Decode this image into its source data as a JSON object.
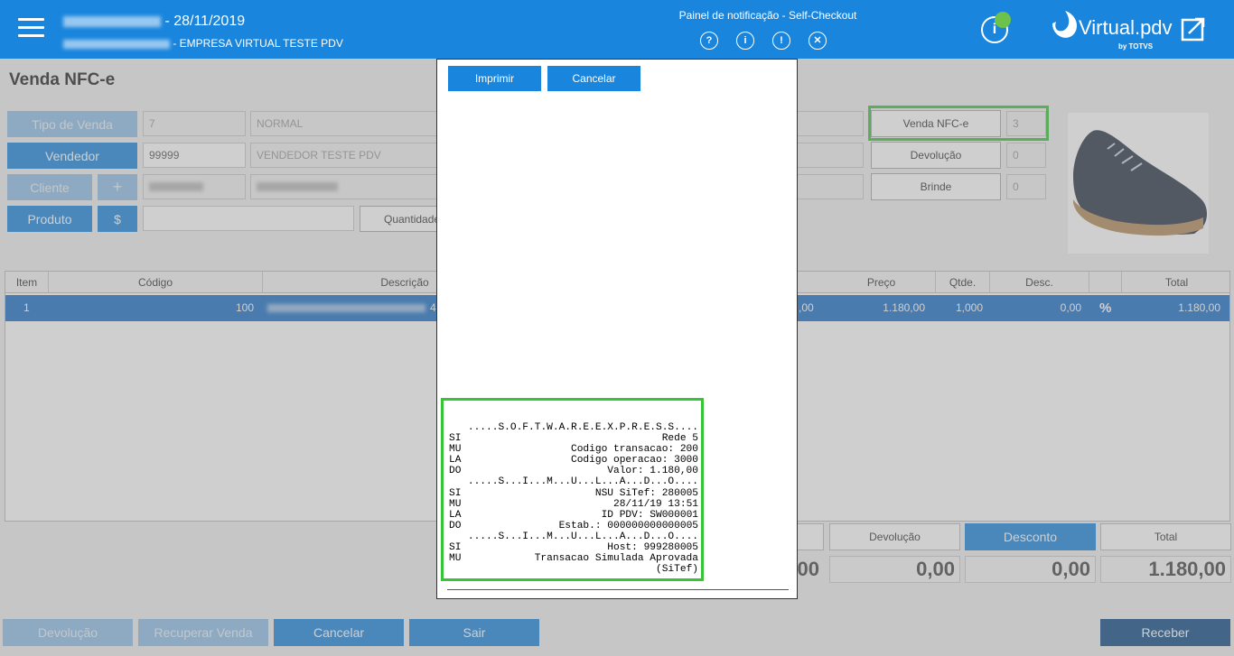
{
  "header": {
    "store_date": "- 28/11/2019",
    "company_name": "- EMPRESA VIRTUAL TESTE PDV",
    "notification_title": "Painel de notificação - Self-Checkout",
    "notification_icons": [
      "question-icon",
      "info-icon",
      "alert-icon",
      "close-icon"
    ],
    "brand_name": "Virtual.pdv",
    "brand_sub": "by TOTVS",
    "accent_color": "#1a85dd",
    "status_color": "#6cc24a"
  },
  "page": {
    "title": "Venda NFC-e"
  },
  "form": {
    "tipo_venda_label": "Tipo de Venda",
    "tipo_venda_code": "7",
    "tipo_venda_desc": "NORMAL",
    "vendedor_label": "Vendedor",
    "vendedor_code": "99999",
    "vendedor_name": "VENDEDOR TESTE PDV",
    "cliente_label": "Cliente",
    "cliente_add": "+",
    "produto_label": "Produto",
    "price_button": "$",
    "quantidade_label": "Quantidade",
    "venda_nfce_label": "Venda NFC-e",
    "venda_nfce_count": "3",
    "devolucao_label": "Devolução",
    "devolucao_count": "0",
    "brinde_label": "Brinde",
    "brinde_count": "0"
  },
  "table": {
    "headers": [
      "Item",
      "Código",
      "Descrição",
      "Preço",
      "Qtde.",
      "Desc.",
      "Total"
    ],
    "rows": [
      {
        "item": "1",
        "codigo": "100",
        "descricao_tail": "4",
        "unit": ",00",
        "preco": "1.180,00",
        "qtde": "1,000",
        "desc": "0,00",
        "total": "1.180,00"
      }
    ]
  },
  "totals": {
    "devolucao_label": "Devolução",
    "desconto_label": "Desconto",
    "total_label": "Total",
    "subtotal_partial": "00",
    "devolucao_value": "0,00",
    "desconto_value": "0,00",
    "total_value": "1.180,00"
  },
  "bottom_buttons": {
    "devolucao": "Devolução",
    "recuperar": "Recuperar Venda",
    "cancelar": "Cancelar",
    "sair": "Sair",
    "receber": "Receber"
  },
  "modal": {
    "print_button": "Imprimir",
    "cancel_button": "Cancelar",
    "receipt_lines": [
      [
        "",
        ".....S.O.F.T.W.A.R.E.E.X.P.R.E.S.S...."
      ],
      [
        "SI",
        "Rede 5"
      ],
      [
        "MU",
        "Codigo transacao: 200"
      ],
      [
        "LA",
        "Codigo operacao: 3000"
      ],
      [
        "DO",
        "Valor: 1.180,00"
      ],
      [
        "",
        ".....S...I...M...U...L...A...D...O...."
      ],
      [
        "SI",
        "NSU SiTef: 280005"
      ],
      [
        "MU",
        "28/11/19 13:51"
      ],
      [
        "LA",
        "ID PDV: SW000001"
      ],
      [
        "DO",
        "Estab.: 000000000000005"
      ],
      [
        "",
        ".....S...I...M...U...L...A...D...O...."
      ],
      [
        "SI",
        "Host: 999280005"
      ],
      [
        "MU",
        "Transacao Simulada Aprovada"
      ],
      [
        "",
        "(SiTef)"
      ]
    ]
  }
}
